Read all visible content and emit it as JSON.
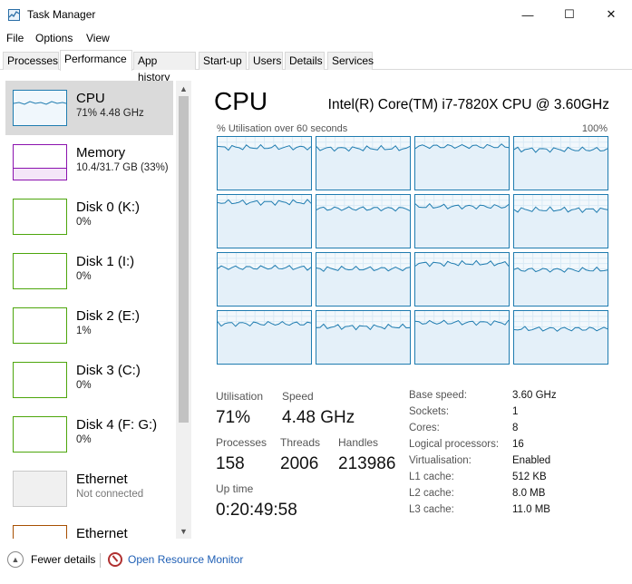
{
  "window": {
    "title": "Task Manager",
    "icon": "task-manager-icon",
    "controls": {
      "minimize": "—",
      "maximize": "☐",
      "close": "✕"
    }
  },
  "menu": [
    "File",
    "Options",
    "View"
  ],
  "tabs": [
    "Processes",
    "Performance",
    "App history",
    "Start-up",
    "Users",
    "Details",
    "Services"
  ],
  "active_tab": "Performance",
  "sidebar": {
    "items": [
      {
        "name": "CPU",
        "sub": "71% 4.48 GHz",
        "color": "#1f7cb0",
        "selected": true
      },
      {
        "name": "Memory",
        "sub": "10.4/31.7 GB (33%)",
        "color": "#8b12ae"
      },
      {
        "name": "Disk 0 (K:)",
        "sub": "0%",
        "color": "#4da60c"
      },
      {
        "name": "Disk 1 (I:)",
        "sub": "0%",
        "color": "#4da60c"
      },
      {
        "name": "Disk 2 (E:)",
        "sub": "1%",
        "color": "#4da60c"
      },
      {
        "name": "Disk 3 (C:)",
        "sub": "0%",
        "color": "#4da60c"
      },
      {
        "name": "Disk 4 (F: G:)",
        "sub": "0%",
        "color": "#4da60c"
      },
      {
        "name": "Ethernet",
        "sub": "Not connected",
        "color": "#c8c8c8"
      },
      {
        "name": "Ethernet",
        "sub": "",
        "color": "#a74f01"
      }
    ]
  },
  "cpu": {
    "title": "CPU",
    "model": "Intel(R) Core(TM) i7-7820X CPU @ 3.60GHz",
    "graph_caption": "% Utilisation over 60 seconds",
    "graph_max": "100%",
    "graph_color": "#1f7cb0",
    "core_levels": [
      0.8,
      0.78,
      0.82,
      0.76,
      0.86,
      0.74,
      0.78,
      0.72,
      0.72,
      0.7,
      0.8,
      0.68,
      0.76,
      0.7,
      0.78,
      0.66
    ],
    "stats": {
      "utilisation_label": "Utilisation",
      "utilisation": "71%",
      "speed_label": "Speed",
      "speed": "4.48 GHz",
      "processes_label": "Processes",
      "processes": "158",
      "threads_label": "Threads",
      "threads": "2006",
      "handles_label": "Handles",
      "handles": "213986",
      "uptime_label": "Up time",
      "uptime": "0:20:49:58"
    },
    "specs": [
      {
        "label": "Base speed:",
        "value": "3.60 GHz"
      },
      {
        "label": "Sockets:",
        "value": "1"
      },
      {
        "label": "Cores:",
        "value": "8"
      },
      {
        "label": "Logical processors:",
        "value": "16"
      },
      {
        "label": "Virtualisation:",
        "value": "Enabled"
      },
      {
        "label": "L1 cache:",
        "value": "512 KB"
      },
      {
        "label": "L2 cache:",
        "value": "8.0 MB"
      },
      {
        "label": "L3 cache:",
        "value": "11.0 MB"
      }
    ]
  },
  "footer": {
    "fewer_details": "Fewer details",
    "resource_monitor": "Open Resource Monitor"
  }
}
